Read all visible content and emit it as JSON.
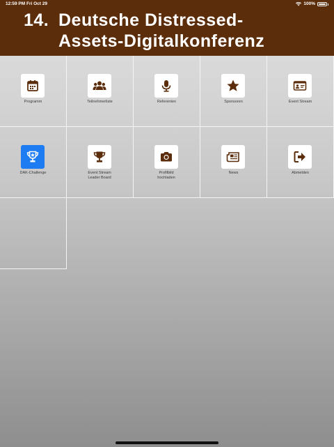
{
  "status_bar": {
    "time": "12:59 PM",
    "date": "Fri Oct 29",
    "battery": "100%"
  },
  "header": {
    "number": "14.",
    "title_line1": "Deutsche Distressed-",
    "title_line2": "Assets-Digitalkonferenz"
  },
  "colors": {
    "header_bg": "#5b2d0b",
    "icon_color": "#5b2d0b",
    "highlight_tile": "#1e7cf2"
  },
  "tiles": [
    {
      "label": "Programm",
      "icon": "calendar-icon"
    },
    {
      "label": "Teilnehmerliste",
      "icon": "users-icon"
    },
    {
      "label": "Referenten",
      "icon": "microphone-icon"
    },
    {
      "label": "Sponsoren",
      "icon": "star-icon"
    },
    {
      "label": "Event Stream",
      "icon": "id-card-icon"
    },
    {
      "label": "DAK-Challenge",
      "icon": "trophy-icon"
    },
    {
      "label": "Event Stream Leader Board",
      "icon": "trophy-icon"
    },
    {
      "label": "Profilbild hochladen",
      "icon": "camera-icon"
    },
    {
      "label": "News",
      "icon": "newspaper-icon"
    },
    {
      "label": "Abmelden",
      "icon": "sign-out-icon"
    }
  ]
}
